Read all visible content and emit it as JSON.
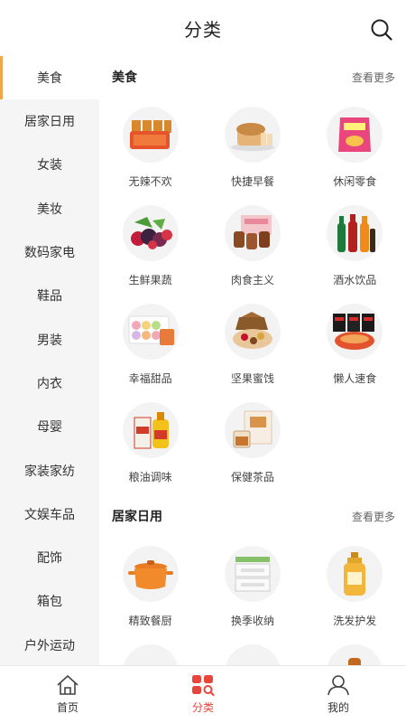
{
  "header": {
    "title": "分类",
    "search_icon": "search-icon"
  },
  "sidebar": {
    "items": [
      {
        "label": "美食",
        "active": true
      },
      {
        "label": "居家日用"
      },
      {
        "label": "女装"
      },
      {
        "label": "美妆"
      },
      {
        "label": "数码家电"
      },
      {
        "label": "鞋品"
      },
      {
        "label": "男装"
      },
      {
        "label": "内衣"
      },
      {
        "label": "母婴"
      },
      {
        "label": "家装家纺"
      },
      {
        "label": "文娱车品"
      },
      {
        "label": "配饰"
      },
      {
        "label": "箱包"
      },
      {
        "label": "户外运动"
      }
    ]
  },
  "sections": [
    {
      "title": "美食",
      "more": "查看更多",
      "items": [
        {
          "label": "无辣不欢",
          "icon": "spicy-snack-icon"
        },
        {
          "label": "快捷早餐",
          "icon": "bread-icon"
        },
        {
          "label": "休闲零食",
          "icon": "chips-icon"
        },
        {
          "label": "生鲜果蔬",
          "icon": "berries-icon"
        },
        {
          "label": "肉食主义",
          "icon": "meat-icon"
        },
        {
          "label": "酒水饮品",
          "icon": "drinks-icon"
        },
        {
          "label": "幸福甜品",
          "icon": "macaron-icon"
        },
        {
          "label": "坚果蜜饯",
          "icon": "nuts-icon"
        },
        {
          "label": "懒人速食",
          "icon": "noodles-icon"
        },
        {
          "label": "粮油调味",
          "icon": "oil-rice-icon"
        },
        {
          "label": "保健茶品",
          "icon": "tea-icon"
        }
      ]
    },
    {
      "title": "居家日用",
      "more": "查看更多",
      "items": [
        {
          "label": "精致餐厨",
          "icon": "pot-icon"
        },
        {
          "label": "换季收纳",
          "icon": "storage-box-icon"
        },
        {
          "label": "洗发护发",
          "icon": "shampoo-icon"
        },
        {
          "label": "",
          "icon": "item-icon"
        },
        {
          "label": "",
          "icon": "item-icon"
        },
        {
          "label": "",
          "icon": "item-icon"
        }
      ]
    }
  ],
  "tabbar": {
    "tabs": [
      {
        "label": "首页",
        "icon": "home-icon"
      },
      {
        "label": "分类",
        "icon": "category-icon",
        "active": true
      },
      {
        "label": "我的",
        "icon": "profile-icon"
      }
    ]
  },
  "colors": {
    "accent": "#e8453c",
    "sidebar_indicator": "#f0a64b",
    "sidebar_bg": "#f5f5f5"
  }
}
